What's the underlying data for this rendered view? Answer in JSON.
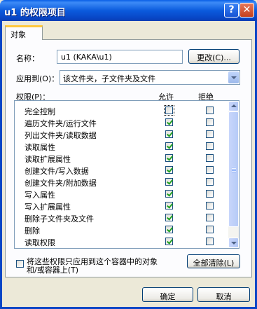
{
  "window": {
    "title": "u1 的权限项目",
    "help_glyph": "?",
    "close_glyph": "✕"
  },
  "tab": {
    "label": "对象"
  },
  "name": {
    "label": "名称：",
    "value": "u1 (KAKA\\u1)",
    "change_button": "更改(C)..."
  },
  "apply_to": {
    "label": "应用到(O)：",
    "selected": "该文件夹，子文件夹及文件"
  },
  "permissions": {
    "label": "权限(P)：",
    "allow_header": "允许",
    "deny_header": "拒绝",
    "rows": [
      {
        "name": "完全控制",
        "allow": false,
        "deny": false
      },
      {
        "name": "遍历文件夹/运行文件",
        "allow": true,
        "deny": false
      },
      {
        "name": "列出文件夹/读取数据",
        "allow": true,
        "deny": false
      },
      {
        "name": "读取属性",
        "allow": true,
        "deny": false
      },
      {
        "name": "读取扩展属性",
        "allow": true,
        "deny": false
      },
      {
        "name": "创建文件/写入数据",
        "allow": true,
        "deny": false
      },
      {
        "name": "创建文件夹/附加数据",
        "allow": true,
        "deny": false
      },
      {
        "name": "写入属性",
        "allow": true,
        "deny": false
      },
      {
        "name": "写入扩展属性",
        "allow": true,
        "deny": false
      },
      {
        "name": "删除子文件夹及文件",
        "allow": true,
        "deny": false
      },
      {
        "name": "删除",
        "allow": true,
        "deny": false
      },
      {
        "name": "读取权限",
        "allow": true,
        "deny": false
      }
    ]
  },
  "apply_only": {
    "checked": false,
    "line1": "将这些权限只应用到这个容器中的对象",
    "line2": "和/或容器上(T)"
  },
  "clear_all_button": "全部清除(L)",
  "ok_button": "确定",
  "cancel_button": "取消"
}
